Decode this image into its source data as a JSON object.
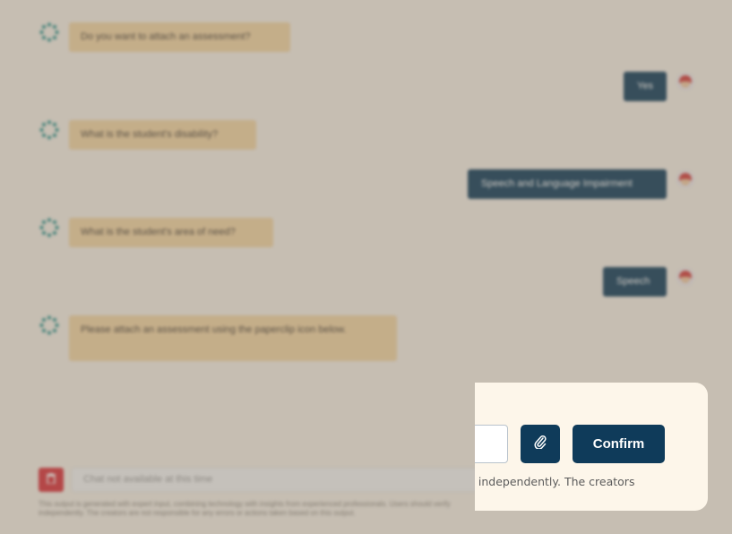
{
  "conversation": [
    {
      "from": "bot",
      "text": "Do you want to attach an assessment?"
    },
    {
      "from": "user",
      "text": "Yes"
    },
    {
      "from": "bot",
      "text": "What is the student's disability?"
    },
    {
      "from": "user",
      "text": "Speech and Language Impairment"
    },
    {
      "from": "bot",
      "text": "What is the student's area of need?"
    },
    {
      "from": "user",
      "text": "Speech"
    },
    {
      "from": "bot",
      "text": "Please attach an assessment using the paperclip icon below."
    }
  ],
  "chat_input": {
    "placeholder": "Chat not available at this time"
  },
  "disclaimer": "This output is generated with expert input, combining technology with insights from experienced professionals. Users should verify independently. The creators are not responsible for any errors or actions taken based on this output.",
  "card": {
    "confirm_label": "Confirm",
    "text": "n independently. The creators"
  },
  "colors": {
    "bot_bubble": "#f3d5a4",
    "user_bubble": "#0f3b5a",
    "accent_teal": "#1a8a86",
    "danger": "#d9303a",
    "card_bg": "#fdf6ea"
  },
  "icons": {
    "bot": "spinner-dots-icon",
    "user": "avatar-icon",
    "trash": "trash-icon",
    "attach": "paperclip-icon"
  }
}
